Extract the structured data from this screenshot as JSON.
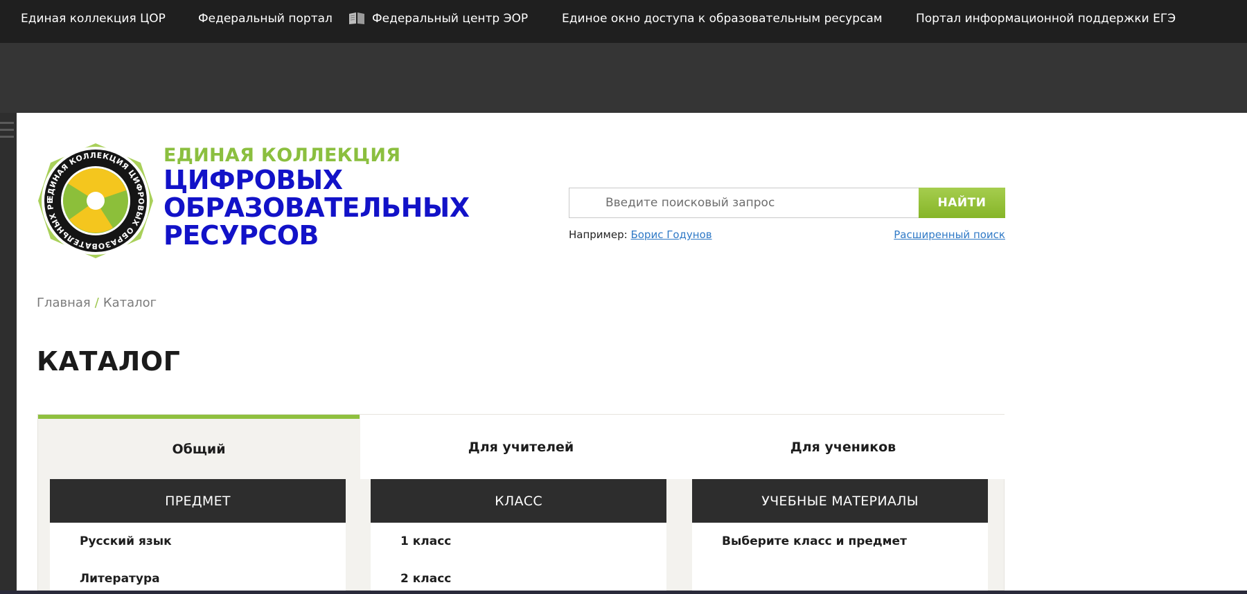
{
  "topnav": {
    "links": [
      "Единая коллекция ЦОР",
      "Федеральный портал",
      "Федеральный центр ЭОР",
      "Единое окно доступа к образовательным ресурсам",
      "Портал информационной поддержки ЕГЭ"
    ],
    "eor_icon": "book-icon"
  },
  "logo": {
    "emblem_text": "ЕДИНАЯ КОЛЛЕКЦИЯ ЦИФРОВЫХ ОБРАЗОВАТЕЛЬНЫХ РЕСУРСОВ",
    "line1": "ЕДИНАЯ КОЛЛЕКЦИЯ",
    "line2": "ЦИФРОВЫХ",
    "line3": "ОБРАЗОВАТЕЛЬНЫХ",
    "line4": "РЕСУРСОВ"
  },
  "search": {
    "placeholder": "Введите поисковый запрос",
    "button": "НАЙТИ",
    "example_label": "Например:",
    "example_link": "Борис Годунов",
    "advanced": "Расширенный поиск"
  },
  "breadcrumb": {
    "home": "Главная",
    "separator": "/",
    "current": "Каталог"
  },
  "page_title": "КАТАЛОГ",
  "tabs": [
    "Общий",
    "Для учителей",
    "Для учеников"
  ],
  "columns": {
    "subject": {
      "header": "ПРЕДМЕТ",
      "items": [
        "Русский язык",
        "Литература"
      ]
    },
    "grade": {
      "header": "КЛАСС",
      "items": [
        "1 класс",
        "2 класс"
      ]
    },
    "materials": {
      "header": "УЧЕБНЫЕ МАТЕРИАЛЫ",
      "items": [
        "Выберите класс и предмет"
      ]
    }
  },
  "colors": {
    "accent_green": "#8fc03f",
    "logo_blue": "#1212c8",
    "link_blue": "#2f79c6",
    "nav_bg": "#1f1f1f"
  }
}
